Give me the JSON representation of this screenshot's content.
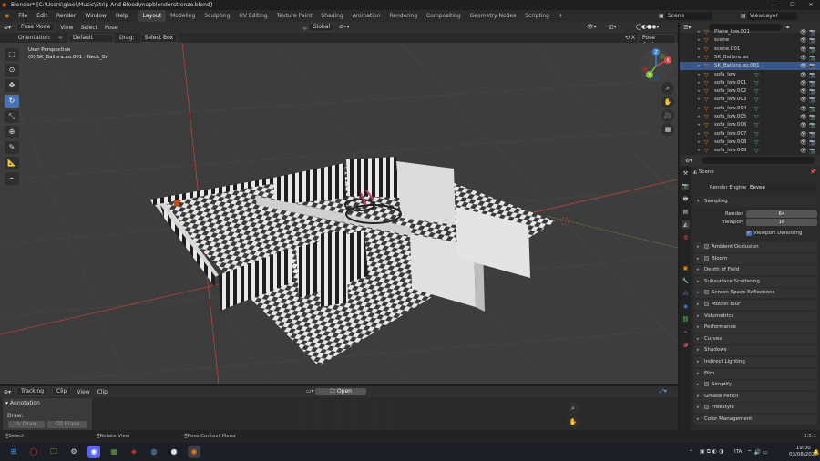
{
  "window": {
    "title": "Blender* [C:\\Users\\gioel\\Music\\Strip And Blood\\mapblenderstronzo.blend]"
  },
  "menus": [
    "File",
    "Edit",
    "Render",
    "Window",
    "Help"
  ],
  "workspaces": [
    "Layout",
    "Modeling",
    "Sculpting",
    "UV Editing",
    "Texture Paint",
    "Shading",
    "Animation",
    "Rendering",
    "Compositing",
    "Geometry Nodes",
    "Scripting"
  ],
  "active_workspace": "Layout",
  "scene_selector": {
    "scene": "Scene",
    "view_layer": "ViewLayer"
  },
  "viewport_header": {
    "mode": "Pose Mode",
    "menus": [
      "View",
      "Select",
      "Pose"
    ],
    "transform_orientation": "Global"
  },
  "viewport_subheader": {
    "orientation_label": "Orientation:",
    "orientation_value": "Default",
    "drag_label": "Drag:",
    "drag_value": "Select Box",
    "pose_options": "Pose Options"
  },
  "viewport_info": {
    "view_name": "User Perspective",
    "object_bone": "(0) SK_Ballora.ao.001 : Neck_Bn"
  },
  "gizmo_axes": {
    "x": "X",
    "y": "Y",
    "z": "Z"
  },
  "outliner": {
    "rows": [
      {
        "name": "Plane_low.001",
        "mesh": false,
        "selected": false
      },
      {
        "name": "scene",
        "mesh": false,
        "selected": false
      },
      {
        "name": "scene.001",
        "mesh": false,
        "selected": false
      },
      {
        "name": "SK_Ballora.ao",
        "mesh": false,
        "selected": false
      },
      {
        "name": "SK_Ballora.ao.001",
        "mesh": true,
        "selected": true
      },
      {
        "name": "sofa_low",
        "mesh": true,
        "selected": false
      },
      {
        "name": "sofa_low.001",
        "mesh": true,
        "selected": false
      },
      {
        "name": "sofa_low.002",
        "mesh": true,
        "selected": false
      },
      {
        "name": "sofa_low.003",
        "mesh": true,
        "selected": false
      },
      {
        "name": "sofa_low.004",
        "mesh": true,
        "selected": false
      },
      {
        "name": "sofa_low.005",
        "mesh": true,
        "selected": false
      },
      {
        "name": "sofa_low.006",
        "mesh": true,
        "selected": false
      },
      {
        "name": "sofa_low.007",
        "mesh": true,
        "selected": false
      },
      {
        "name": "sofa_low.008",
        "mesh": true,
        "selected": false
      },
      {
        "name": "sofa_low.009",
        "mesh": true,
        "selected": false
      }
    ]
  },
  "properties": {
    "context": "Scene",
    "render_engine_label": "Render Engine",
    "render_engine_value": "Eevee",
    "sampling": {
      "title": "Sampling",
      "render_label": "Render",
      "render_value": "64",
      "viewport_label": "Viewport",
      "viewport_value": "16",
      "denoise_label": "Viewport Denoising"
    },
    "panels": [
      {
        "label": "Ambient Occlusion",
        "checkbox": true
      },
      {
        "label": "Bloom",
        "checkbox": true
      },
      {
        "label": "Depth of Field",
        "checkbox": false
      },
      {
        "label": "Subsurface Scattering",
        "checkbox": false
      },
      {
        "label": "Screen Space Reflections",
        "checkbox": true
      },
      {
        "label": "Motion Blur",
        "checkbox": true
      },
      {
        "label": "Volumetrics",
        "checkbox": false
      },
      {
        "label": "Performance",
        "checkbox": false
      },
      {
        "label": "Curves",
        "checkbox": false
      },
      {
        "label": "Shadows",
        "checkbox": false
      },
      {
        "label": "Indirect Lighting",
        "checkbox": false
      },
      {
        "label": "Film",
        "checkbox": false
      },
      {
        "label": "Simplify",
        "checkbox": true
      },
      {
        "label": "Grease Pencil",
        "checkbox": false
      },
      {
        "label": "Freestyle",
        "checkbox": true
      },
      {
        "label": "Color Management",
        "checkbox": false
      }
    ]
  },
  "clip_editor": {
    "tracking": "Tracking",
    "clip_mode": "Clip",
    "menus": [
      "View",
      "Clip"
    ],
    "open_button": "Open",
    "annotation_title": "Annotation",
    "draw_label": "Draw:",
    "draw_button": "Draw",
    "erase_button": "Erase"
  },
  "statusbar": {
    "select": "Select",
    "rotate": "Rotate View",
    "context_menu": "Pose Context Menu",
    "version": "3.5.1"
  },
  "taskbar": {
    "lang": "ITA",
    "time": "19:00",
    "date": "03/08/2025"
  }
}
